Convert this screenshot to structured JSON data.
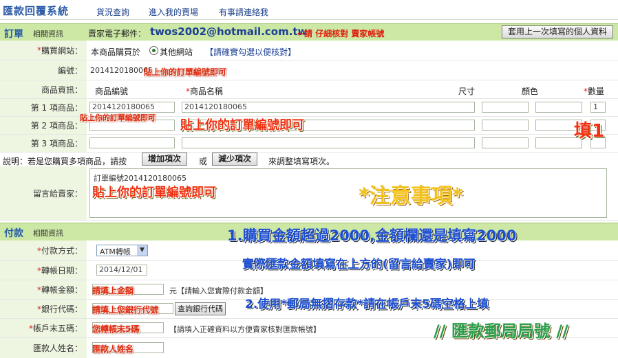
{
  "header": {
    "title": "匯款回覆系統",
    "nav": [
      "貨況查詢",
      "進入我的賣場",
      "有事請連絡我"
    ]
  },
  "order_section": {
    "title": "訂單",
    "subtitle": "相關資訊",
    "seller_email_label": "賣家電子郵件：",
    "seller_email": "twos2002@hotmail.com.tw",
    "email_note": "←請 仔細核對 賣家帳號",
    "reuse_button": "套用上一次填寫的個人資料"
  },
  "fields": {
    "site_label": "購買網站：",
    "site_text": "本商品購買於",
    "site_option": "其他網站",
    "site_hint": "【請確實勾選以便核對】",
    "order_no_label": "編號：",
    "order_no_value": "2014120180065",
    "order_no_note": "貼上你的訂單編號即可",
    "product_info_label": "商品資訊：",
    "col_product_no": "商品編號",
    "col_product_name": "商品名稱",
    "col_size": "尺寸",
    "col_color": "顏色",
    "col_qty": "數量",
    "item1_label": "第 1 項商品：",
    "item2_label": "第 2 項商品：",
    "item3_label": "第 3 項商品：",
    "item1_no": "2014120180065",
    "item1_name": "2014120180065",
    "item1_qty": "1",
    "item_note_small": "貼上你的訂單編號即可",
    "item_note_big": "貼上你的訂單編號即可",
    "qty_note": "填1",
    "explain_text": "說明：若是您購買多項商品，請按",
    "add_button": "增加項次",
    "or_text": "或",
    "reduce_button": "減少項次",
    "explain_tail": "來調整填寫項次。",
    "message_label": "留言給賣家：",
    "message_value": "訂單編號2014120180065",
    "message_note": "貼上你的訂單編號即可",
    "attention_note": "*注意事項*"
  },
  "payment_section": {
    "title": "付款",
    "subtitle": "相關資訊",
    "method_label": "付款方式：",
    "method_value": "ATM轉帳",
    "date_label": "轉帳日期：",
    "date_value": "2014/12/01",
    "amount_label": "轉帳金額：",
    "amount_note": "請填上金額",
    "amount_unit": "元【請輸入您實際付款金額】",
    "bank_label": "銀行代碼：",
    "bank_note": "請填上您銀行代號",
    "bank_button": "查詢銀行代碼",
    "account_label": "帳戶末五碼：",
    "account_note": "您轉帳末5碼",
    "account_hint": "【請填入正確資料以方便賣家核對匯款帳號】",
    "remitter_label": "匯款人姓名：",
    "remitter_note": "匯款人姓名"
  },
  "notes": {
    "note1": "1.購買金額超過2000,金額欄還是填寫2000",
    "note2": "實際匯款金額填寫在上方的(留言給賣家)即可",
    "note3": "2.使用*郵局無摺存款*請在帳戶末5碼空格上填",
    "note4": "// 匯款郵局局號 //"
  }
}
